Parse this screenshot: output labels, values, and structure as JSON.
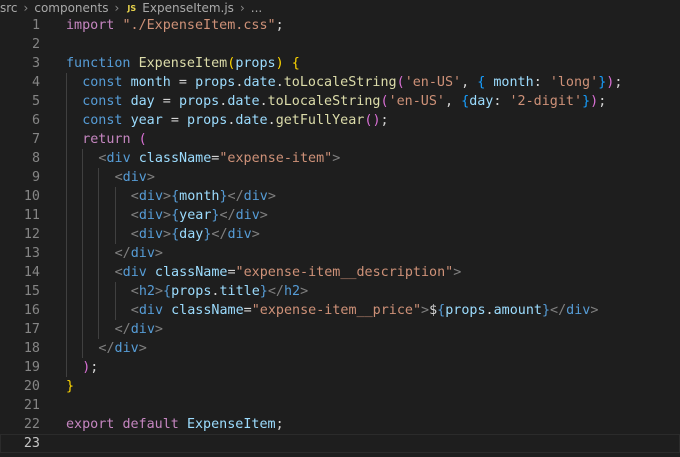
{
  "breadcrumb": {
    "items": [
      "src",
      "components",
      "ExpenseItem.js",
      "..."
    ],
    "file_icon": "JS"
  },
  "colors": {
    "background": "#1e1e1e",
    "keyword": "#c586c0",
    "string": "#ce9178",
    "function": "#dcdcaa",
    "variable": "#9cdcfe",
    "storage": "#569cd6",
    "bracket1": "#ffd700",
    "bracket2": "#da70d6",
    "bracket3": "#179fff"
  },
  "editor": {
    "current_line": 23,
    "lines": [
      {
        "n": 1,
        "indent": 0,
        "tokens": [
          [
            "kw",
            "import"
          ],
          [
            "pu",
            " "
          ],
          [
            "st",
            "\"./ExpenseItem.css\""
          ],
          [
            "pu",
            ";"
          ]
        ]
      },
      {
        "n": 2,
        "indent": 0,
        "tokens": []
      },
      {
        "n": 3,
        "indent": 0,
        "tokens": [
          [
            "kb",
            "function"
          ],
          [
            "pu",
            " "
          ],
          [
            "fn",
            "ExpenseItem"
          ],
          [
            "p1",
            "("
          ],
          [
            "vr",
            "props"
          ],
          [
            "p1",
            ")"
          ],
          [
            "pu",
            " "
          ],
          [
            "p1",
            "{"
          ]
        ]
      },
      {
        "n": 4,
        "indent": 1,
        "tokens": [
          [
            "kb",
            "const"
          ],
          [
            "pu",
            " "
          ],
          [
            "vr",
            "month"
          ],
          [
            "pu",
            " = "
          ],
          [
            "vr",
            "props"
          ],
          [
            "pu",
            "."
          ],
          [
            "vr",
            "date"
          ],
          [
            "pu",
            "."
          ],
          [
            "fn",
            "toLocaleString"
          ],
          [
            "p2",
            "("
          ],
          [
            "st",
            "'en-US'"
          ],
          [
            "pu",
            ", "
          ],
          [
            "p3",
            "{"
          ],
          [
            "pu",
            " "
          ],
          [
            "vr",
            "month"
          ],
          [
            "pu",
            ": "
          ],
          [
            "st",
            "'long'"
          ],
          [
            "p3",
            "}"
          ],
          [
            "p2",
            ")"
          ],
          [
            "pu",
            ";"
          ]
        ]
      },
      {
        "n": 5,
        "indent": 1,
        "tokens": [
          [
            "kb",
            "const"
          ],
          [
            "pu",
            " "
          ],
          [
            "vr",
            "day"
          ],
          [
            "pu",
            " = "
          ],
          [
            "vr",
            "props"
          ],
          [
            "pu",
            "."
          ],
          [
            "vr",
            "date"
          ],
          [
            "pu",
            "."
          ],
          [
            "fn",
            "toLocaleString"
          ],
          [
            "p2",
            "("
          ],
          [
            "st",
            "'en-US'"
          ],
          [
            "pu",
            ", "
          ],
          [
            "p3",
            "{"
          ],
          [
            "vr",
            "day"
          ],
          [
            "pu",
            ": "
          ],
          [
            "st",
            "'2-digit'"
          ],
          [
            "p3",
            "}"
          ],
          [
            "p2",
            ")"
          ],
          [
            "pu",
            ";"
          ]
        ]
      },
      {
        "n": 6,
        "indent": 1,
        "tokens": [
          [
            "kb",
            "const"
          ],
          [
            "pu",
            " "
          ],
          [
            "vr",
            "year"
          ],
          [
            "pu",
            " = "
          ],
          [
            "vr",
            "props"
          ],
          [
            "pu",
            "."
          ],
          [
            "vr",
            "date"
          ],
          [
            "pu",
            "."
          ],
          [
            "fn",
            "getFullYear"
          ],
          [
            "p2",
            "("
          ],
          [
            "p2",
            ")"
          ],
          [
            "pu",
            ";"
          ]
        ]
      },
      {
        "n": 7,
        "indent": 1,
        "tokens": [
          [
            "kw",
            "return"
          ],
          [
            "pu",
            " "
          ],
          [
            "p2",
            "("
          ]
        ]
      },
      {
        "n": 8,
        "indent": 2,
        "tokens": [
          [
            "ang",
            "<"
          ],
          [
            "tg",
            "div"
          ],
          [
            "pu",
            " "
          ],
          [
            "at",
            "className"
          ],
          [
            "pu",
            "="
          ],
          [
            "st",
            "\"expense-item\""
          ],
          [
            "ang",
            ">"
          ]
        ]
      },
      {
        "n": 9,
        "indent": 3,
        "tokens": [
          [
            "ang",
            "<"
          ],
          [
            "tg",
            "div"
          ],
          [
            "ang",
            ">"
          ]
        ]
      },
      {
        "n": 10,
        "indent": 4,
        "tokens": [
          [
            "ang",
            "<"
          ],
          [
            "tg",
            "div"
          ],
          [
            "ang",
            ">"
          ],
          [
            "kb",
            "{"
          ],
          [
            "vr",
            "month"
          ],
          [
            "kb",
            "}"
          ],
          [
            "ang",
            "</"
          ],
          [
            "tg",
            "div"
          ],
          [
            "ang",
            ">"
          ]
        ]
      },
      {
        "n": 11,
        "indent": 4,
        "tokens": [
          [
            "ang",
            "<"
          ],
          [
            "tg",
            "div"
          ],
          [
            "ang",
            ">"
          ],
          [
            "kb",
            "{"
          ],
          [
            "vr",
            "year"
          ],
          [
            "kb",
            "}"
          ],
          [
            "ang",
            "</"
          ],
          [
            "tg",
            "div"
          ],
          [
            "ang",
            ">"
          ]
        ]
      },
      {
        "n": 12,
        "indent": 4,
        "tokens": [
          [
            "ang",
            "<"
          ],
          [
            "tg",
            "div"
          ],
          [
            "ang",
            ">"
          ],
          [
            "kb",
            "{"
          ],
          [
            "vr",
            "day"
          ],
          [
            "kb",
            "}"
          ],
          [
            "ang",
            "</"
          ],
          [
            "tg",
            "div"
          ],
          [
            "ang",
            ">"
          ]
        ]
      },
      {
        "n": 13,
        "indent": 3,
        "tokens": [
          [
            "ang",
            "</"
          ],
          [
            "tg",
            "div"
          ],
          [
            "ang",
            ">"
          ]
        ]
      },
      {
        "n": 14,
        "indent": 3,
        "tokens": [
          [
            "ang",
            "<"
          ],
          [
            "tg",
            "div"
          ],
          [
            "pu",
            " "
          ],
          [
            "at",
            "className"
          ],
          [
            "pu",
            "="
          ],
          [
            "st",
            "\"expense-item__description\""
          ],
          [
            "ang",
            ">"
          ]
        ]
      },
      {
        "n": 15,
        "indent": 4,
        "tokens": [
          [
            "ang",
            "<"
          ],
          [
            "tg",
            "h2"
          ],
          [
            "ang",
            ">"
          ],
          [
            "kb",
            "{"
          ],
          [
            "vr",
            "props"
          ],
          [
            "pu",
            "."
          ],
          [
            "vr",
            "title"
          ],
          [
            "kb",
            "}"
          ],
          [
            "ang",
            "</"
          ],
          [
            "tg",
            "h2"
          ],
          [
            "ang",
            ">"
          ]
        ]
      },
      {
        "n": 16,
        "indent": 4,
        "tokens": [
          [
            "ang",
            "<"
          ],
          [
            "tg",
            "div"
          ],
          [
            "pu",
            " "
          ],
          [
            "at",
            "className"
          ],
          [
            "pu",
            "="
          ],
          [
            "st",
            "\"expense-item__price\""
          ],
          [
            "ang",
            ">"
          ],
          [
            "pu",
            "$"
          ],
          [
            "kb",
            "{"
          ],
          [
            "vr",
            "props"
          ],
          [
            "pu",
            "."
          ],
          [
            "vr",
            "amount"
          ],
          [
            "kb",
            "}"
          ],
          [
            "ang",
            "</"
          ],
          [
            "tg",
            "div"
          ],
          [
            "ang",
            ">"
          ]
        ]
      },
      {
        "n": 17,
        "indent": 3,
        "tokens": [
          [
            "ang",
            "</"
          ],
          [
            "tg",
            "div"
          ],
          [
            "ang",
            ">"
          ]
        ]
      },
      {
        "n": 18,
        "indent": 2,
        "tokens": [
          [
            "ang",
            "</"
          ],
          [
            "tg",
            "div"
          ],
          [
            "ang",
            ">"
          ]
        ]
      },
      {
        "n": 19,
        "indent": 1,
        "tokens": [
          [
            "p2",
            ")"
          ],
          [
            "pu",
            ";"
          ]
        ]
      },
      {
        "n": 20,
        "indent": 0,
        "tokens": [
          [
            "p1",
            "}"
          ]
        ]
      },
      {
        "n": 21,
        "indent": 0,
        "tokens": []
      },
      {
        "n": 22,
        "indent": 0,
        "tokens": [
          [
            "kw",
            "export"
          ],
          [
            "pu",
            " "
          ],
          [
            "kw",
            "default"
          ],
          [
            "pu",
            " "
          ],
          [
            "vr",
            "ExpenseItem"
          ],
          [
            "pu",
            ";"
          ]
        ]
      },
      {
        "n": 23,
        "indent": 0,
        "tokens": []
      }
    ]
  }
}
